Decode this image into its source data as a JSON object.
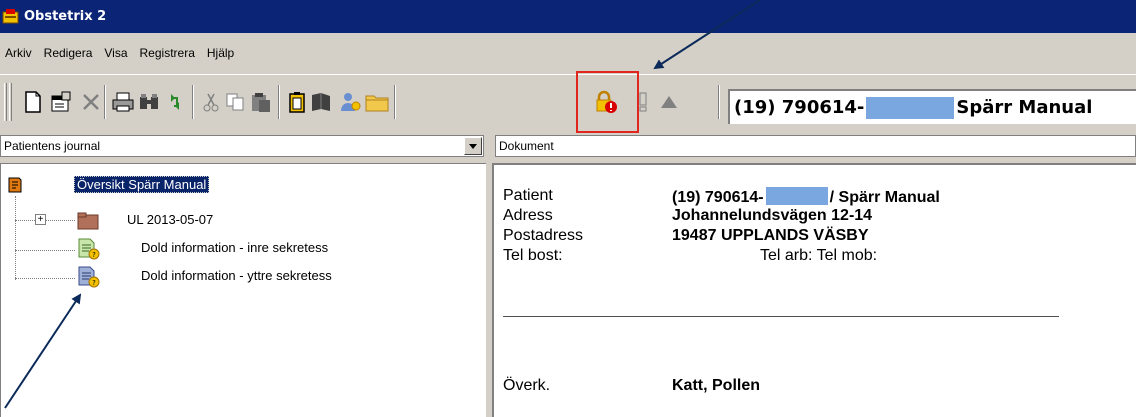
{
  "window": {
    "title": "Obstetrix 2"
  },
  "menu": {
    "items": [
      "Arkiv",
      "Redigera",
      "Visa",
      "Registrera",
      "Hjälp"
    ]
  },
  "toolbar": {
    "patient_prefix": "(19) 790614-",
    "patient_suffix": "Spärr Manual",
    "buttons": [
      "new-document-icon",
      "properties-icon",
      "delete-icon",
      "print-icon",
      "find-icon",
      "refresh-icon",
      "cut-icon",
      "copy-icon",
      "paste-icon",
      "clipboard-icon",
      "book-icon",
      "person-icon",
      "folder-icon",
      "lock-warning-icon",
      "exclamation-icon",
      "triangle-up-icon"
    ]
  },
  "left_panel": {
    "combo_value": "Patientens journal",
    "tree": {
      "root": "Översikt Spärr Manual",
      "children": [
        "UL 2013-05-07",
        "Dold information - inre sekretess",
        "Dold information - yttre sekretess"
      ]
    }
  },
  "document": {
    "header": "Dokument",
    "rows": [
      {
        "label": "Patient",
        "value_prefix": "(19) 790614-",
        "value_suffix": "/ Spärr Manual"
      },
      {
        "label": "Adress",
        "value": "Johannelundsvägen 12-14"
      },
      {
        "label": "Postadress",
        "value": "19487  UPPLANDS VÄSBY"
      },
      {
        "label": "Tel bost:",
        "value": "Tel arb:  Tel mob:"
      },
      {
        "label": "Överk.",
        "value": "Katt, Pollen"
      }
    ]
  },
  "colors": {
    "titlebar": "#0b2476",
    "highlight": "#e0261f",
    "mask": "#7aa7e0",
    "chrome": "#d4d0c8"
  }
}
